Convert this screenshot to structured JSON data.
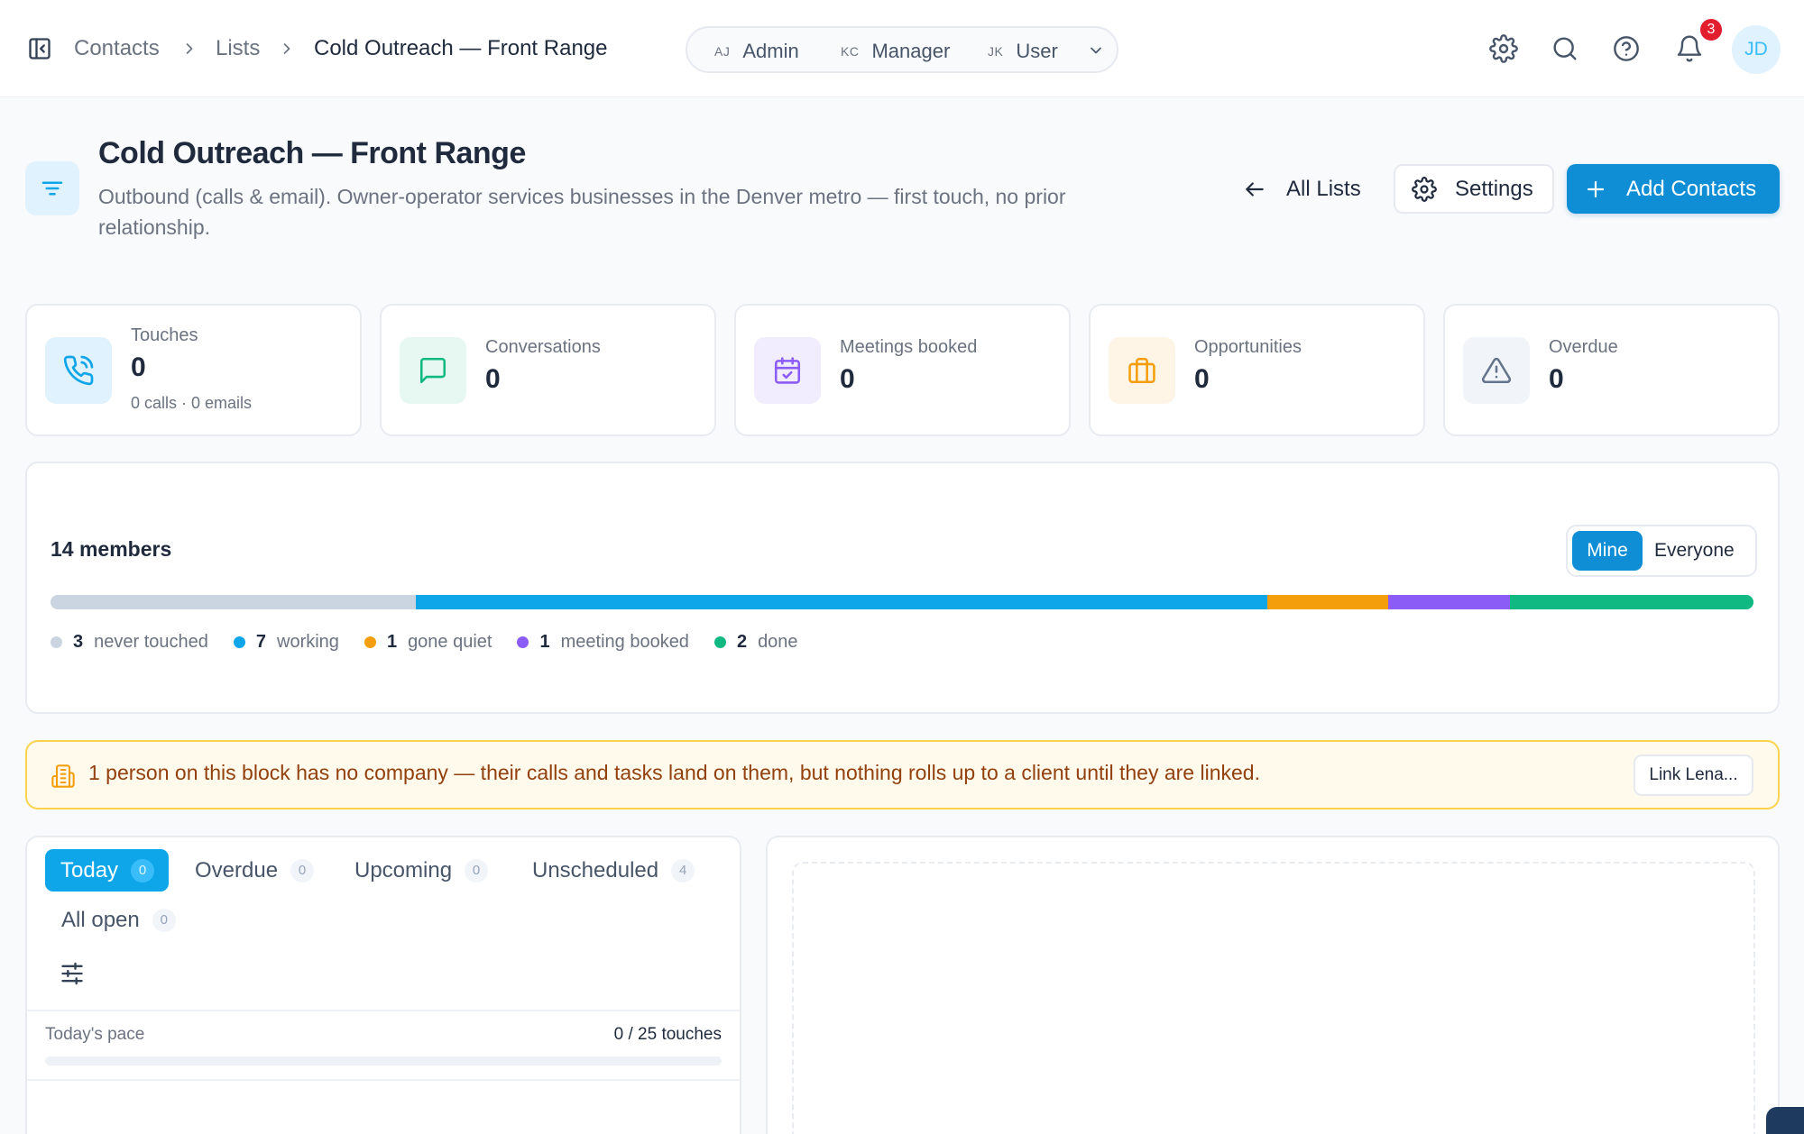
{
  "breadcrumb": {
    "items": [
      "Contacts",
      "Lists"
    ],
    "current": "Cold Outreach — Front Range"
  },
  "roles": [
    {
      "initials": "AJ",
      "label": "Admin"
    },
    {
      "initials": "KC",
      "label": "Manager"
    },
    {
      "initials": "JK",
      "label": "User"
    }
  ],
  "header_icons": [
    "gear-icon",
    "search-icon",
    "help-circle-icon",
    "bell-icon"
  ],
  "notifications": {
    "count": "3"
  },
  "user": {
    "initials": "JD"
  },
  "page": {
    "title": "Cold Outreach — Front Range",
    "description": "Outbound (calls & email). Owner-operator services businesses in the Denver metro — first touch, no prior relationship."
  },
  "actions": {
    "all_lists": "All Lists",
    "settings": "Settings",
    "add_contacts": "Add Contacts"
  },
  "stats": [
    {
      "label": "Touches",
      "value": "0",
      "sub": "0 calls · 0 emails",
      "icon": "phone-icon",
      "accent": "#0ea5e9"
    },
    {
      "label": "Conversations",
      "value": "0",
      "icon": "chat-icon",
      "accent": "#10b981"
    },
    {
      "label": "Meetings booked",
      "value": "0",
      "icon": "calendar-check-icon",
      "accent": "#8b5cf6"
    },
    {
      "label": "Opportunities",
      "value": "0",
      "icon": "briefcase-icon",
      "accent": "#f59e0b"
    },
    {
      "label": "Overdue",
      "value": "0",
      "icon": "warning-triangle-icon",
      "accent": "#64748b"
    }
  ],
  "members": {
    "title": "14 members",
    "total": 14,
    "scope": {
      "mine": "Mine",
      "everyone": "Everyone",
      "selected": "Mine"
    },
    "segments": [
      {
        "count": 3,
        "label": "never touched",
        "color": "#cbd5e1"
      },
      {
        "count": 7,
        "label": "working",
        "color": "#0ea5e9"
      },
      {
        "count": 1,
        "label": "gone quiet",
        "color": "#f59e0b"
      },
      {
        "count": 1,
        "label": "meeting booked",
        "color": "#8b5cf6"
      },
      {
        "count": 2,
        "label": "done",
        "color": "#10b981"
      }
    ]
  },
  "warning": {
    "text": "1 person on this block has no company — their calls and tasks land on them, but nothing rolls up to a client until they are linked.",
    "action": "Link Lena..."
  },
  "tasks": {
    "tabs": [
      {
        "label": "Today",
        "count": "0",
        "active": true
      },
      {
        "label": "Overdue",
        "count": "0"
      },
      {
        "label": "Upcoming",
        "count": "0"
      },
      {
        "label": "Unscheduled",
        "count": "4"
      },
      {
        "label": "All open",
        "count": "0"
      }
    ],
    "pace": {
      "label": "Today's pace",
      "done": 0,
      "goal": 25,
      "display": "0 / 25 touches"
    }
  }
}
